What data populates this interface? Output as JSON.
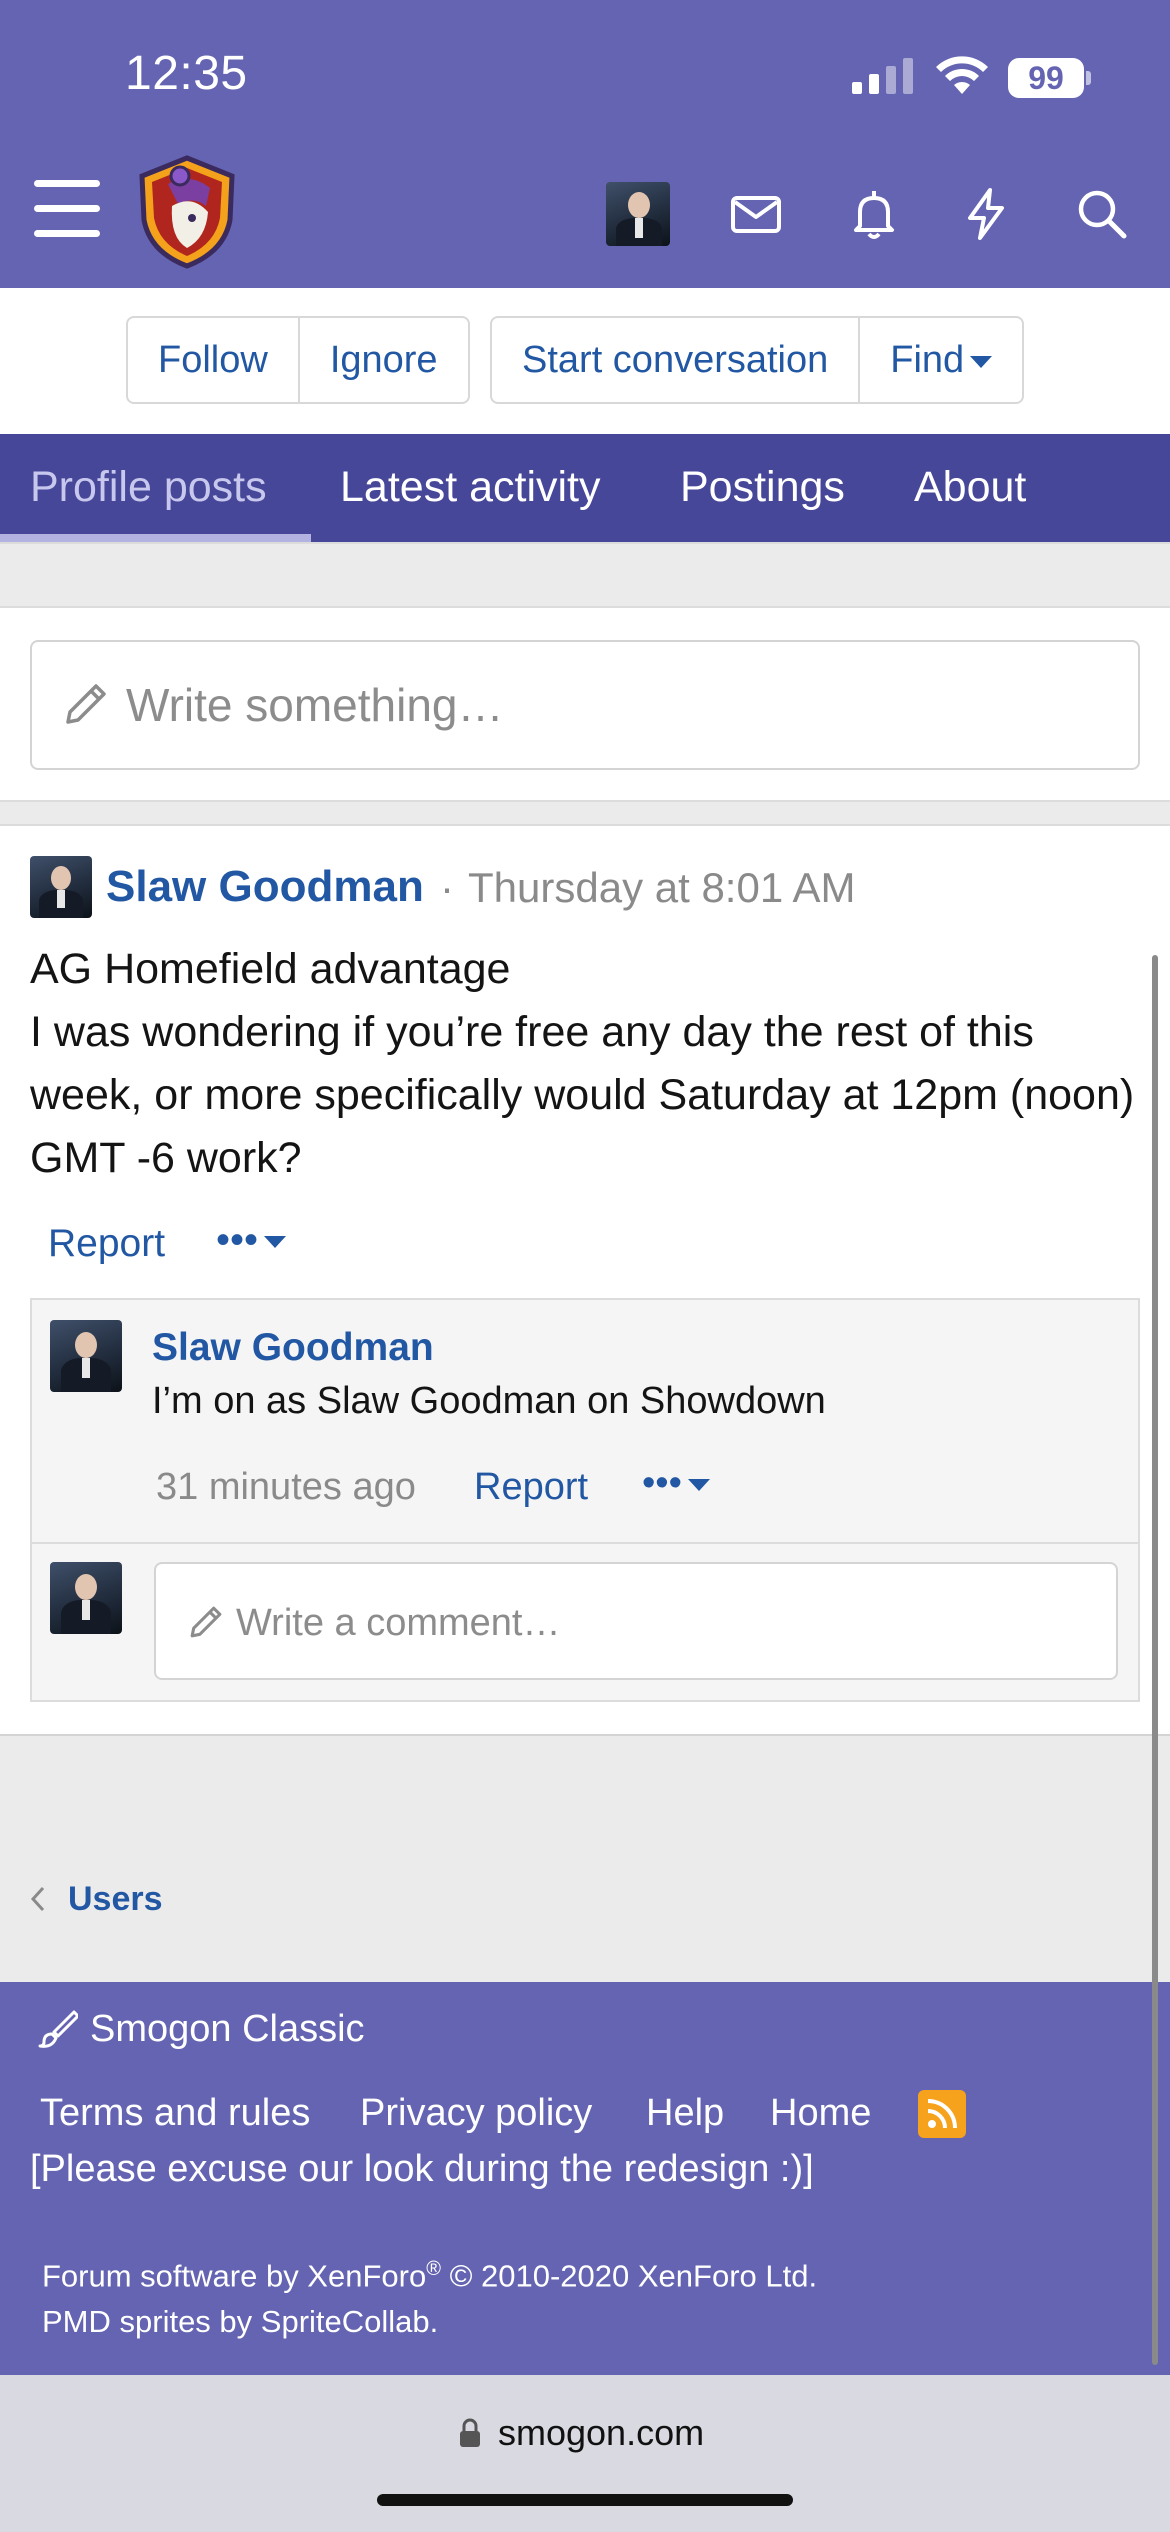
{
  "status_bar": {
    "time": "12:35",
    "battery": "99"
  },
  "header": {
    "icons": [
      "menu-icon",
      "site-logo",
      "avatar",
      "mail-icon",
      "bell-icon",
      "bolt-icon",
      "search-icon"
    ],
    "bar_color": "#6464b2"
  },
  "actions": {
    "follow": "Follow",
    "ignore": "Ignore",
    "start_conversation": "Start conversation",
    "find": "Find"
  },
  "tabs": [
    {
      "label": "Profile posts",
      "active": true
    },
    {
      "label": "Latest activity",
      "active": false
    },
    {
      "label": "Postings",
      "active": false
    },
    {
      "label": "About",
      "active": false
    }
  ],
  "composer": {
    "placeholder": "Write something…"
  },
  "post": {
    "author": "Slaw Goodman",
    "separator": "·",
    "time": "Thursday at 8:01 AM",
    "lines": [
      "AG Homefield advantage",
      "I was wondering if you’re free any day the rest of this week, or more specifically would Saturday at 12pm (noon) GMT -6 work?"
    ],
    "report": "Report",
    "more": "•••"
  },
  "comment": {
    "author": "Slaw Goodman",
    "text": "I’m on as Slaw Goodman on Showdown",
    "time": "31 minutes ago",
    "report": "Report",
    "more": "•••"
  },
  "reply": {
    "placeholder": "Write a comment…"
  },
  "breadcrumb": {
    "label": "Users"
  },
  "footer": {
    "style": "Smogon Classic",
    "links": [
      "Terms and rules",
      "Privacy policy",
      "Help",
      "Home"
    ],
    "note": "[Please excuse our look during the redesign :)]",
    "software_prefix": "Forum software by XenForo",
    "software_reg": "®",
    "software_suffix": " © 2010-2020 XenForo Ltd.",
    "sprites": "PMD sprites by SpriteCollab."
  },
  "browser": {
    "url": "smogon.com"
  },
  "colors": {
    "accent": "#6464b2",
    "tabs_bg": "#474799",
    "link": "#2157a3",
    "rss": "#f7a21c"
  }
}
